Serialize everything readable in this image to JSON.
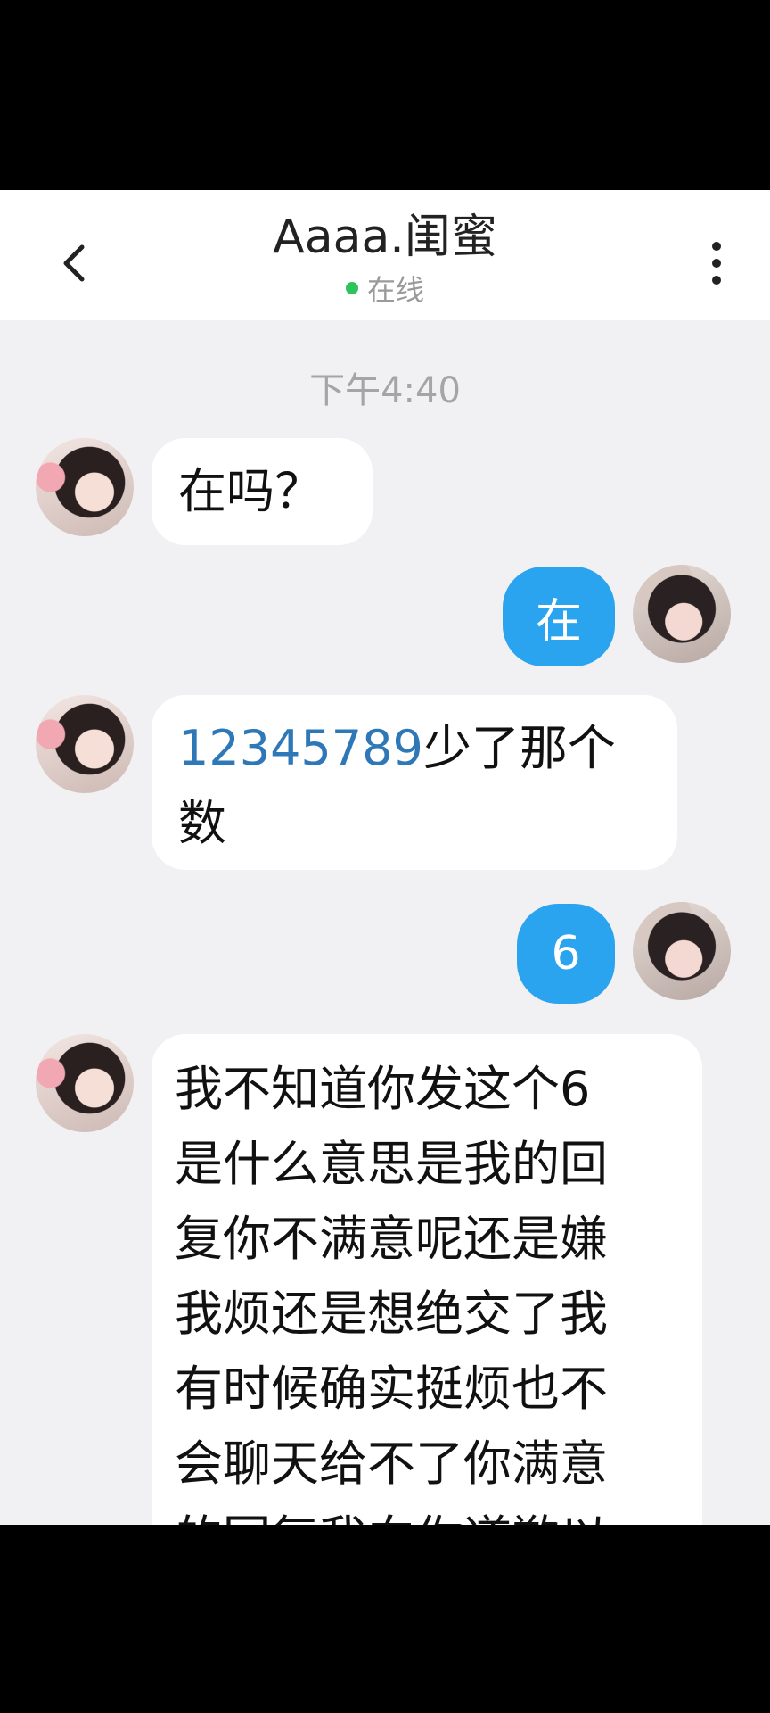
{
  "header": {
    "title": "Aaaa.闺蜜",
    "status": "在线",
    "status_color": "#2ec25e",
    "back_icon": "chevron-left-icon",
    "menu_icon": "more-vertical-icon"
  },
  "chat": {
    "timestamp": "下午4:40",
    "messages": [
      {
        "side": "in",
        "text": "在吗？"
      },
      {
        "side": "out",
        "text": "在"
      },
      {
        "side": "in",
        "number": "12345789",
        "text_line1": "少了那个",
        "text_line2": "数"
      },
      {
        "side": "out",
        "text": "6"
      },
      {
        "side": "in",
        "lines": [
          "我不知道你发这个6",
          "是什么意思是我的回",
          "复你不满意呢还是嫌",
          "我烦还是想绝交了我",
          "有时候确实挺烦也不",
          "会聊天给不了你满意",
          "的回复我向你道歉以"
        ]
      }
    ]
  },
  "colors": {
    "outgoing_bubble": "#2ba4ef",
    "incoming_bubble": "#ffffff",
    "background": "#f1f1f3"
  }
}
